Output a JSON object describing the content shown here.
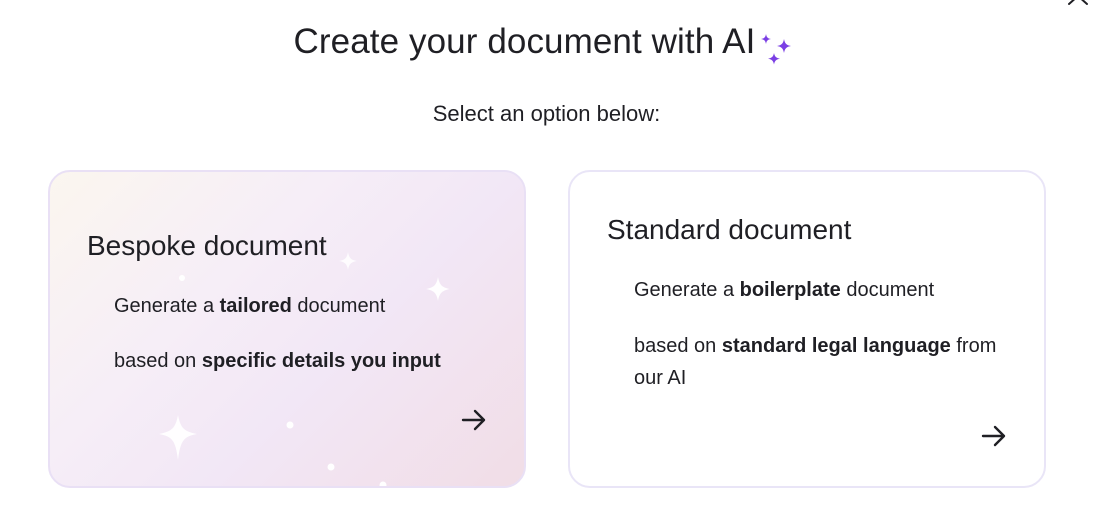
{
  "header": {
    "title": "Create your document with AI",
    "subtitle": "Select an option below:",
    "sparkle_icon": "sparkle-icon",
    "close_icon": "close-icon"
  },
  "cards": [
    {
      "title": "Bespoke document",
      "line1": {
        "pre": "Generate a ",
        "bold": "tailored",
        "post": " document"
      },
      "line2": {
        "pre": "based on ",
        "bold": "specific details you input",
        "post": ""
      },
      "arrow_icon": "arrow-right-icon"
    },
    {
      "title": "Standard document",
      "line1": {
        "pre": "Generate a ",
        "bold": "boilerplate",
        "post": " document"
      },
      "line2": {
        "pre": "based on ",
        "bold": "standard legal language",
        "post": " from our AI"
      },
      "arrow_icon": "arrow-right-icon"
    }
  ],
  "colors": {
    "accent": "#7b3fe4",
    "text": "#1f1f24",
    "card_border": "#e7e2f7"
  }
}
